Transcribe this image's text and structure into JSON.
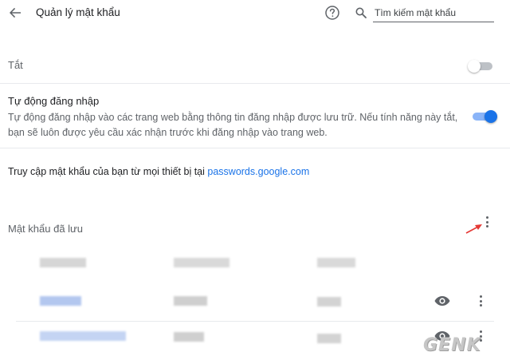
{
  "header": {
    "title": "Quản lý mật khẩu",
    "back_icon": "arrow-back-icon",
    "help_icon": "help-circle-icon",
    "search_icon": "search-icon",
    "search_placeholder": "Tìm kiếm mật khẩu",
    "search_value": ""
  },
  "offer_to_save": {
    "label": "Tắt",
    "enabled": false
  },
  "auto_signin": {
    "title": "Tự động đăng nhập",
    "description": "Tự động đăng nhập vào các trang web bằng thông tin đăng nhập được lưu trữ. Nếu tính năng này tắt, bạn sẽ luôn được yêu cầu xác nhận trước khi đăng nhập vào trang web.",
    "enabled": true
  },
  "access": {
    "text": "Truy cập mật khẩu của bạn từ mọi thiết bị tại ",
    "link_text": "passwords.google.com"
  },
  "saved_passwords": {
    "title": "Mật khẩu đã lưu",
    "more_icon": "more-vert-icon",
    "annotation_icon": "red-arrow-icon",
    "row_icons": [
      "eye-icon",
      "more-vert-icon"
    ]
  },
  "colors": {
    "accent": "#1a73e8",
    "toggle_on_track": "#8ab4f8",
    "annotation_arrow": "#e53935",
    "secondary_text": "#5f6368"
  },
  "watermark": "GENK"
}
